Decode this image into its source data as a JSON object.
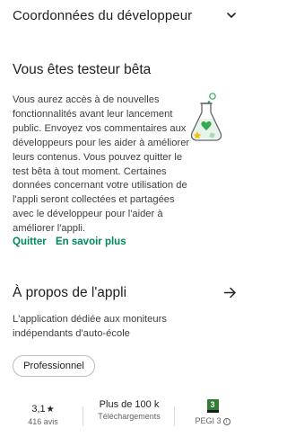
{
  "developer_section": {
    "title": "Coordonnées du développeur",
    "chevron_icon": "chevron-down-icon"
  },
  "beta": {
    "title": "Vous êtes testeur bêta",
    "body": "Vous aurez accès à de nouvelles fonctionnalités avant leur lancement public. Envoyez vos commentaires aux développeurs pour les aider à améliorer leurs contenus. Vous pouvez quitter le test bêta à tout moment. Certaines données concernant votre utilisation de l'appli seront collectées et partagées avec le développeur pour l'aider à améliorer l'appli.",
    "illustration_icon": "beta-flask-icon",
    "actions": {
      "quit_label": "Quitter",
      "learn_more_label": "En savoir plus"
    }
  },
  "about": {
    "title": "À propos de l'appli",
    "arrow_icon": "arrow-right-icon",
    "description": "L'application dédiée aux moniteurs indépendants d'auto-école",
    "category_chip": "Professionnel"
  },
  "stats": {
    "rating_value": "3,1",
    "rating_star": "★",
    "reviews_label": "416 avis",
    "installs_value": "Plus de 100 k",
    "installs_label": "Téléchargements",
    "pegi_badge": "3",
    "pegi_label": "PEGI 3",
    "pegi_info_icon": "info-icon"
  },
  "colors": {
    "accent_green": "#01875f",
    "text_primary": "#202124",
    "text_secondary": "#3c4043"
  }
}
